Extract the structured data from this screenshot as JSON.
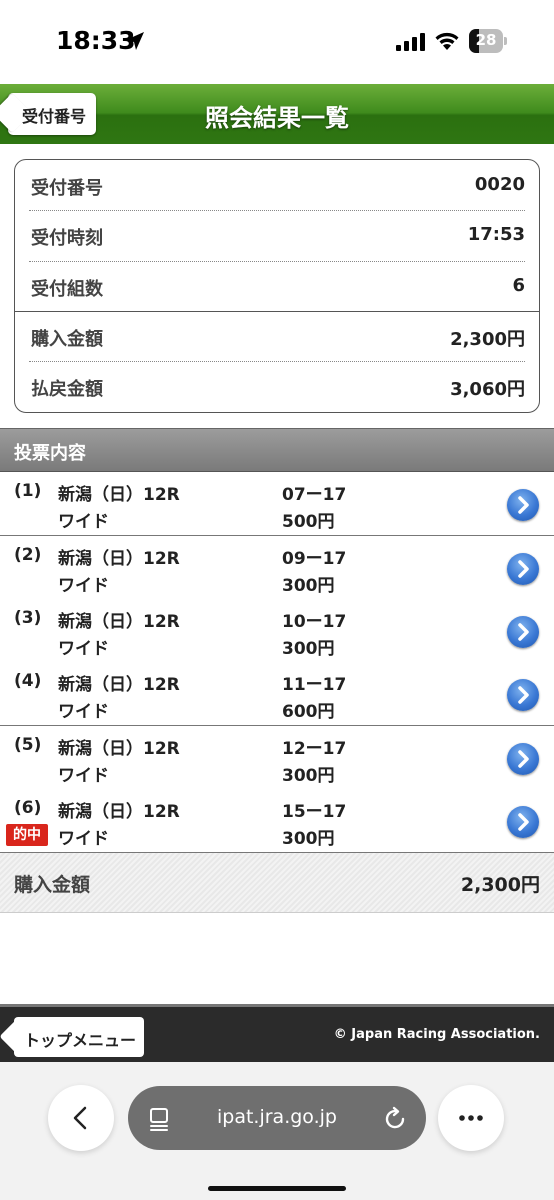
{
  "status_bar": {
    "time": "18:33",
    "battery": "28",
    "icons": [
      "location-arrow-icon",
      "signal-icon",
      "wifi-icon",
      "battery-icon"
    ]
  },
  "header": {
    "back_label": "受付番号",
    "title": "照会結果一覧",
    "accent_color": "#3f8b1d"
  },
  "summary": {
    "receipt_number": {
      "label": "受付番号",
      "value": "0020"
    },
    "receipt_time": {
      "label": "受付時刻",
      "value": "17:53"
    },
    "set_count": {
      "label": "受付組数",
      "value": "6"
    },
    "purchase_amount": {
      "label": "購入金額",
      "value": "2,300円"
    },
    "payout_amount": {
      "label": "払戻金額",
      "value": "3,060円"
    }
  },
  "votes": {
    "section_title": "投票内容",
    "items": [
      {
        "num": "(1)",
        "race": "新潟（日）12R",
        "type": "ワイド",
        "combo": "07ー17",
        "amount": "500円",
        "hit": ""
      },
      {
        "num": "(2)",
        "race": "新潟（日）12R",
        "type": "ワイド",
        "combo": "09ー17",
        "amount": "300円",
        "hit": ""
      },
      {
        "num": "(3)",
        "race": "新潟（日）12R",
        "type": "ワイド",
        "combo": "10ー17",
        "amount": "300円",
        "hit": ""
      },
      {
        "num": "(4)",
        "race": "新潟（日）12R",
        "type": "ワイド",
        "combo": "11ー17",
        "amount": "600円",
        "hit": ""
      },
      {
        "num": "(5)",
        "race": "新潟（日）12R",
        "type": "ワイド",
        "combo": "12ー17",
        "amount": "300円",
        "hit": ""
      },
      {
        "num": "(6)",
        "race": "新潟（日）12R",
        "type": "ワイド",
        "combo": "15ー17",
        "amount": "300円",
        "hit": "的中"
      }
    ],
    "hit_color": "#d9261c"
  },
  "total": {
    "label": "購入金額",
    "value": "2,300円"
  },
  "footer": {
    "top_menu_label": "トップメニュー",
    "copyright": "© Japan Racing Association."
  },
  "browser": {
    "url": "ipat.jra.go.jp"
  }
}
